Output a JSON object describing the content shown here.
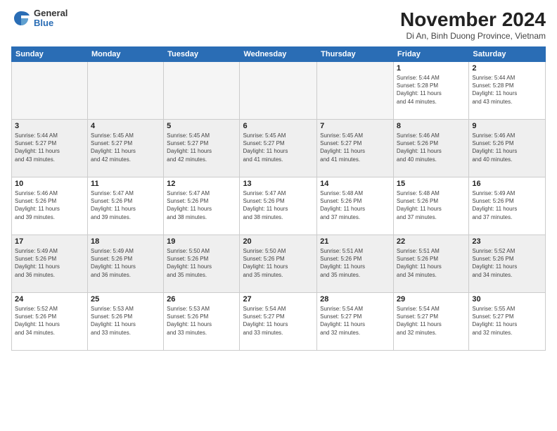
{
  "logo": {
    "general": "General",
    "blue": "Blue"
  },
  "title": "November 2024",
  "subtitle": "Di An, Binh Duong Province, Vietnam",
  "headers": [
    "Sunday",
    "Monday",
    "Tuesday",
    "Wednesday",
    "Thursday",
    "Friday",
    "Saturday"
  ],
  "weeks": [
    [
      {
        "day": "",
        "info": ""
      },
      {
        "day": "",
        "info": ""
      },
      {
        "day": "",
        "info": ""
      },
      {
        "day": "",
        "info": ""
      },
      {
        "day": "",
        "info": ""
      },
      {
        "day": "1",
        "info": "Sunrise: 5:44 AM\nSunset: 5:28 PM\nDaylight: 11 hours\nand 44 minutes."
      },
      {
        "day": "2",
        "info": "Sunrise: 5:44 AM\nSunset: 5:28 PM\nDaylight: 11 hours\nand 43 minutes."
      }
    ],
    [
      {
        "day": "3",
        "info": "Sunrise: 5:44 AM\nSunset: 5:27 PM\nDaylight: 11 hours\nand 43 minutes."
      },
      {
        "day": "4",
        "info": "Sunrise: 5:45 AM\nSunset: 5:27 PM\nDaylight: 11 hours\nand 42 minutes."
      },
      {
        "day": "5",
        "info": "Sunrise: 5:45 AM\nSunset: 5:27 PM\nDaylight: 11 hours\nand 42 minutes."
      },
      {
        "day": "6",
        "info": "Sunrise: 5:45 AM\nSunset: 5:27 PM\nDaylight: 11 hours\nand 41 minutes."
      },
      {
        "day": "7",
        "info": "Sunrise: 5:45 AM\nSunset: 5:27 PM\nDaylight: 11 hours\nand 41 minutes."
      },
      {
        "day": "8",
        "info": "Sunrise: 5:46 AM\nSunset: 5:26 PM\nDaylight: 11 hours\nand 40 minutes."
      },
      {
        "day": "9",
        "info": "Sunrise: 5:46 AM\nSunset: 5:26 PM\nDaylight: 11 hours\nand 40 minutes."
      }
    ],
    [
      {
        "day": "10",
        "info": "Sunrise: 5:46 AM\nSunset: 5:26 PM\nDaylight: 11 hours\nand 39 minutes."
      },
      {
        "day": "11",
        "info": "Sunrise: 5:47 AM\nSunset: 5:26 PM\nDaylight: 11 hours\nand 39 minutes."
      },
      {
        "day": "12",
        "info": "Sunrise: 5:47 AM\nSunset: 5:26 PM\nDaylight: 11 hours\nand 38 minutes."
      },
      {
        "day": "13",
        "info": "Sunrise: 5:47 AM\nSunset: 5:26 PM\nDaylight: 11 hours\nand 38 minutes."
      },
      {
        "day": "14",
        "info": "Sunrise: 5:48 AM\nSunset: 5:26 PM\nDaylight: 11 hours\nand 37 minutes."
      },
      {
        "day": "15",
        "info": "Sunrise: 5:48 AM\nSunset: 5:26 PM\nDaylight: 11 hours\nand 37 minutes."
      },
      {
        "day": "16",
        "info": "Sunrise: 5:49 AM\nSunset: 5:26 PM\nDaylight: 11 hours\nand 37 minutes."
      }
    ],
    [
      {
        "day": "17",
        "info": "Sunrise: 5:49 AM\nSunset: 5:26 PM\nDaylight: 11 hours\nand 36 minutes."
      },
      {
        "day": "18",
        "info": "Sunrise: 5:49 AM\nSunset: 5:26 PM\nDaylight: 11 hours\nand 36 minutes."
      },
      {
        "day": "19",
        "info": "Sunrise: 5:50 AM\nSunset: 5:26 PM\nDaylight: 11 hours\nand 35 minutes."
      },
      {
        "day": "20",
        "info": "Sunrise: 5:50 AM\nSunset: 5:26 PM\nDaylight: 11 hours\nand 35 minutes."
      },
      {
        "day": "21",
        "info": "Sunrise: 5:51 AM\nSunset: 5:26 PM\nDaylight: 11 hours\nand 35 minutes."
      },
      {
        "day": "22",
        "info": "Sunrise: 5:51 AM\nSunset: 5:26 PM\nDaylight: 11 hours\nand 34 minutes."
      },
      {
        "day": "23",
        "info": "Sunrise: 5:52 AM\nSunset: 5:26 PM\nDaylight: 11 hours\nand 34 minutes."
      }
    ],
    [
      {
        "day": "24",
        "info": "Sunrise: 5:52 AM\nSunset: 5:26 PM\nDaylight: 11 hours\nand 34 minutes."
      },
      {
        "day": "25",
        "info": "Sunrise: 5:53 AM\nSunset: 5:26 PM\nDaylight: 11 hours\nand 33 minutes."
      },
      {
        "day": "26",
        "info": "Sunrise: 5:53 AM\nSunset: 5:26 PM\nDaylight: 11 hours\nand 33 minutes."
      },
      {
        "day": "27",
        "info": "Sunrise: 5:54 AM\nSunset: 5:27 PM\nDaylight: 11 hours\nand 33 minutes."
      },
      {
        "day": "28",
        "info": "Sunrise: 5:54 AM\nSunset: 5:27 PM\nDaylight: 11 hours\nand 32 minutes."
      },
      {
        "day": "29",
        "info": "Sunrise: 5:54 AM\nSunset: 5:27 PM\nDaylight: 11 hours\nand 32 minutes."
      },
      {
        "day": "30",
        "info": "Sunrise: 5:55 AM\nSunset: 5:27 PM\nDaylight: 11 hours\nand 32 minutes."
      }
    ]
  ]
}
